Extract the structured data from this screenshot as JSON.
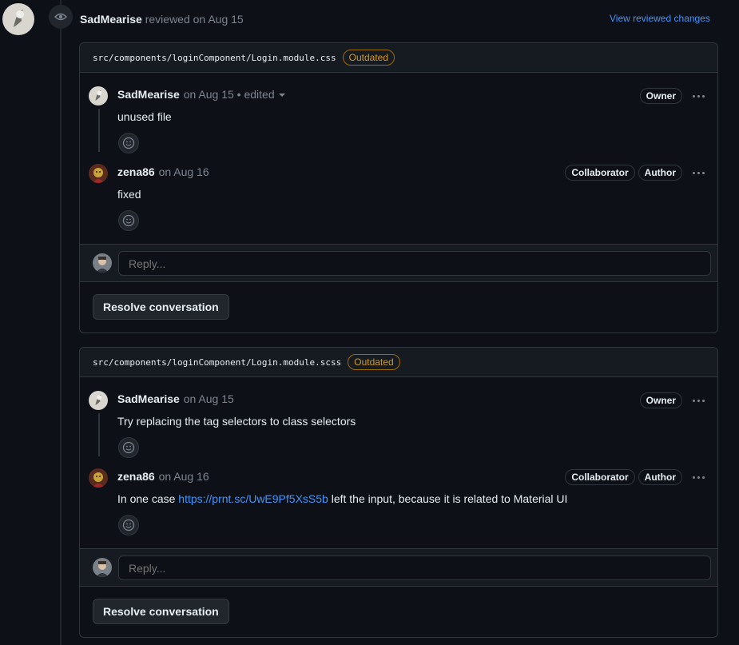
{
  "review": {
    "author": "SadMearise",
    "action": " reviewed on Aug 15",
    "view_changes": "View reviewed changes"
  },
  "threads": [
    {
      "file": "src/components/loginComponent/Login.module.css",
      "status": "Outdated",
      "comments": [
        {
          "author": "SadMearise",
          "meta": " on Aug 15 • edited",
          "body": "unused file",
          "labels": [
            "Owner"
          ]
        },
        {
          "author": "zena86",
          "meta": " on Aug 16",
          "body": "fixed",
          "labels": [
            "Collaborator",
            "Author"
          ]
        }
      ],
      "reply_placeholder": "Reply...",
      "resolve_label": "Resolve conversation"
    },
    {
      "file": "src/components/loginComponent/Login.module.scss",
      "status": "Outdated",
      "comments": [
        {
          "author": "SadMearise",
          "meta": " on Aug 15",
          "body": "Try replacing the tag selectors to class selectors",
          "labels": [
            "Owner"
          ]
        },
        {
          "author": "zena86",
          "meta": " on Aug 16",
          "body_prefix": "In one case ",
          "link": "https://prnt.sc/UwE9Pf5XsS5b",
          "body_suffix": " left the input, because it is related to Material UI",
          "labels": [
            "Collaborator",
            "Author"
          ]
        }
      ],
      "reply_placeholder": "Reply...",
      "resolve_label": "Resolve conversation"
    }
  ],
  "icons": [
    "eye-icon",
    "smiley-icon",
    "kebab-icon",
    "caret-down-icon"
  ],
  "colors": {
    "background": "#0d1117",
    "link": "#4493f8",
    "outdated": "#d29922",
    "border": "#30363d"
  }
}
